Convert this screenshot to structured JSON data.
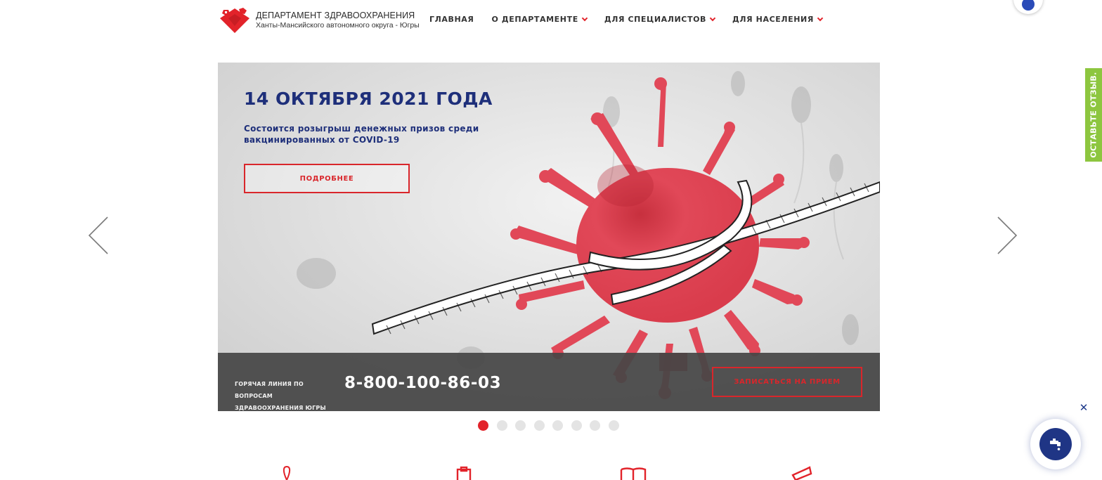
{
  "header": {
    "logo_title": "ДЕПАРТАМЕНТ ЗДРАВООХРАНЕНИЯ",
    "logo_subtitle": "Ханты-Мансийского автономного округа - Югры",
    "nav": [
      {
        "label": "ГЛАВНАЯ",
        "has_dropdown": false
      },
      {
        "label": "О ДЕПАРТАМЕНТЕ",
        "has_dropdown": true
      },
      {
        "label": "ДЛЯ СПЕЦИАЛИСТОВ",
        "has_dropdown": true
      },
      {
        "label": "ДЛЯ НАСЕЛЕНИЯ",
        "has_dropdown": true
      }
    ]
  },
  "slider": {
    "title": "14 ОКТЯБРЯ 2021 ГОДА",
    "text": "Состоится розыгрыш денежных призов среди вакцинированных от COVID-19",
    "more_button": "ПОДРОБНЕЕ",
    "hotline_label": "ГОРЯЧАЯ ЛИНИЯ ПО ВОПРОСАМ ЗДРАВООХРАНЕНИЯ ЮГРЫ",
    "hotline_number": "8-800-100-86-03",
    "appointment_button": "ЗАПИСАТЬСЯ НА ПРИЕМ",
    "slide_count": 8,
    "active_slide": 1
  },
  "feedback_tab": "ОСТАВЬТЕ ОТЗЫВ.",
  "widget_close": "✕",
  "icons": {
    "prev": "chevron-left-icon",
    "next": "chevron-right-icon",
    "widget": "faucet-icon"
  },
  "colors": {
    "brand_red": "#e2232a",
    "title_blue": "#1e2f7a",
    "feedback_green": "#8dc63f",
    "widget_blue": "#1f3585"
  }
}
